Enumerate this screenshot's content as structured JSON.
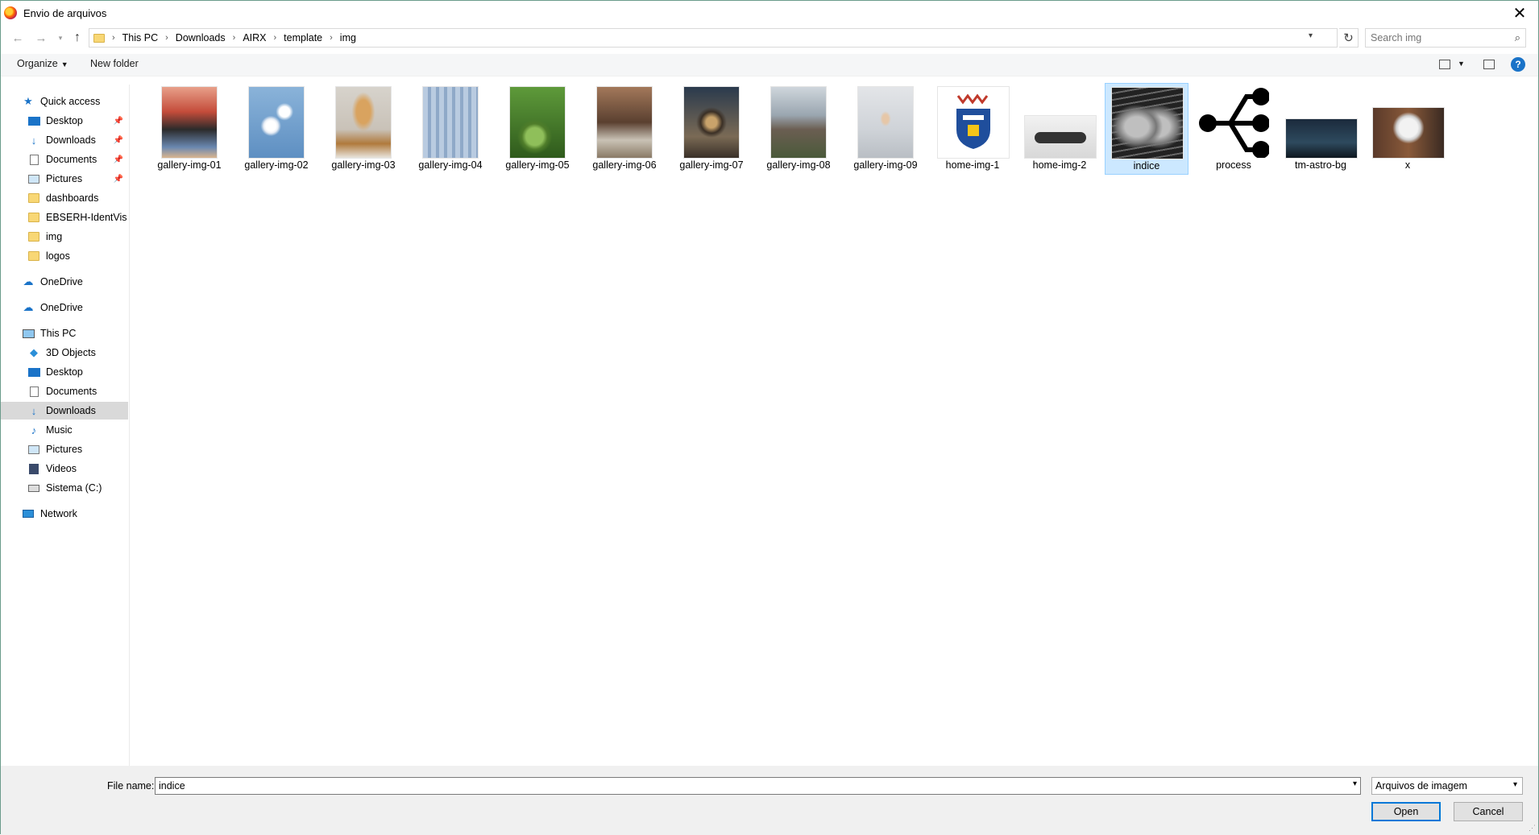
{
  "window": {
    "title": "Envio de arquivos",
    "close_icon": "close-icon",
    "app_icon": "firefox-icon"
  },
  "nav": {
    "back_icon": "arrow-left-icon",
    "forward_icon": "arrow-right-icon",
    "recent_icon": "chevron-down-icon",
    "up_icon": "arrow-up-icon",
    "breadcrumbs": [
      "This PC",
      "Downloads",
      "AIRX",
      "template",
      "img"
    ],
    "refresh_icon": "refresh-icon",
    "search_placeholder": "Search img"
  },
  "toolbar": {
    "organize_label": "Organize",
    "new_folder_label": "New folder"
  },
  "sidebar": {
    "quick_access": "Quick access",
    "quick_items": [
      {
        "label": "Desktop",
        "pinned": true
      },
      {
        "label": "Downloads",
        "pinned": true
      },
      {
        "label": "Documents",
        "pinned": true
      },
      {
        "label": "Pictures",
        "pinned": true
      },
      {
        "label": "dashboards",
        "pinned": false
      },
      {
        "label": "EBSERH-IdentVis",
        "pinned": false
      },
      {
        "label": "img",
        "pinned": false
      },
      {
        "label": "logos",
        "pinned": false
      }
    ],
    "onedrive_1": "OneDrive",
    "onedrive_2": "OneDrive",
    "this_pc": "This PC",
    "pc_items": [
      "3D Objects",
      "Desktop",
      "Documents",
      "Downloads",
      "Music",
      "Pictures",
      "Videos",
      "Sistema (C:)"
    ],
    "network": "Network",
    "selected": "Downloads"
  },
  "files": [
    {
      "name": "gallery-img-01"
    },
    {
      "name": "gallery-img-02"
    },
    {
      "name": "gallery-img-03"
    },
    {
      "name": "gallery-img-04"
    },
    {
      "name": "gallery-img-05"
    },
    {
      "name": "gallery-img-06"
    },
    {
      "name": "gallery-img-07"
    },
    {
      "name": "gallery-img-08"
    },
    {
      "name": "gallery-img-09"
    },
    {
      "name": "home-img-1"
    },
    {
      "name": "home-img-2"
    },
    {
      "name": "indice",
      "selected": true
    },
    {
      "name": "process"
    },
    {
      "name": "tm-astro-bg"
    },
    {
      "name": "x"
    }
  ],
  "footer": {
    "file_name_label": "File name:",
    "file_name_value": "indice",
    "file_type": "Arquivos de imagem",
    "open_label": "Open",
    "cancel_label": "Cancel"
  },
  "colors": {
    "selection": "#cce8ff",
    "selection_border": "#99d1ff",
    "primary_border": "#0078d7",
    "help": "#1a73c8"
  }
}
